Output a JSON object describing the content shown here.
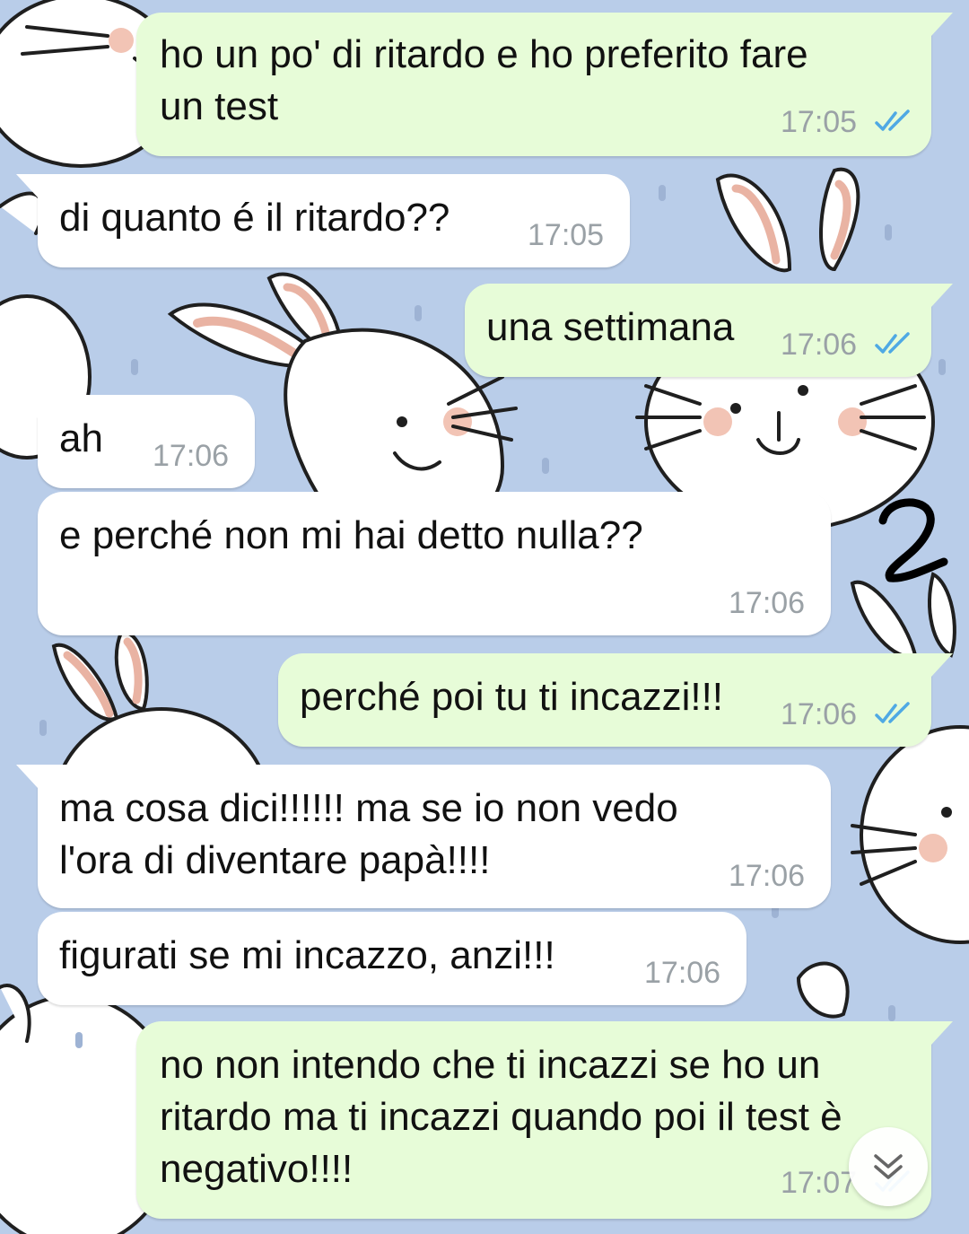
{
  "conversation": {
    "messages": [
      {
        "direction": "outgoing",
        "text": "ho un po' di ritardo e ho preferito fare\nun test",
        "time": "17:05",
        "status": "read"
      },
      {
        "direction": "incoming",
        "text": "di quanto é il ritardo??",
        "time": "17:05"
      },
      {
        "direction": "outgoing",
        "text": "una settimana",
        "time": "17:06",
        "status": "read"
      },
      {
        "direction": "incoming",
        "text": "ah",
        "time": "17:06"
      },
      {
        "direction": "incoming",
        "text": "e perché non mi hai detto nulla??",
        "time": "17:06"
      },
      {
        "direction": "outgoing",
        "text": "perché poi tu ti incazzi!!!",
        "time": "17:06",
        "status": "read"
      },
      {
        "direction": "incoming",
        "text": "ma cosa dici!!!!!! ma se io non vedo\nl'ora di diventare papà!!!!",
        "time": "17:06"
      },
      {
        "direction": "incoming",
        "text": "figurati se mi incazzo, anzi!!!",
        "time": "17:06"
      },
      {
        "direction": "outgoing",
        "text": "no non intendo che ti incazzi se ho un\nritardo ma ti incazzi quando poi il test è\nnegativo!!!!",
        "time": "17:07",
        "status": "read"
      }
    ]
  },
  "overlay": {
    "annotation_text": "2",
    "scroll_button_icon": "double-chevron-down-icon"
  },
  "colors": {
    "wallpaper": "#b9cde9",
    "outgoing_bubble": "#e7fcd8",
    "incoming_bubble": "#ffffff",
    "read_ticks": "#4fa9e4",
    "time_text": "#9aa1a6"
  }
}
